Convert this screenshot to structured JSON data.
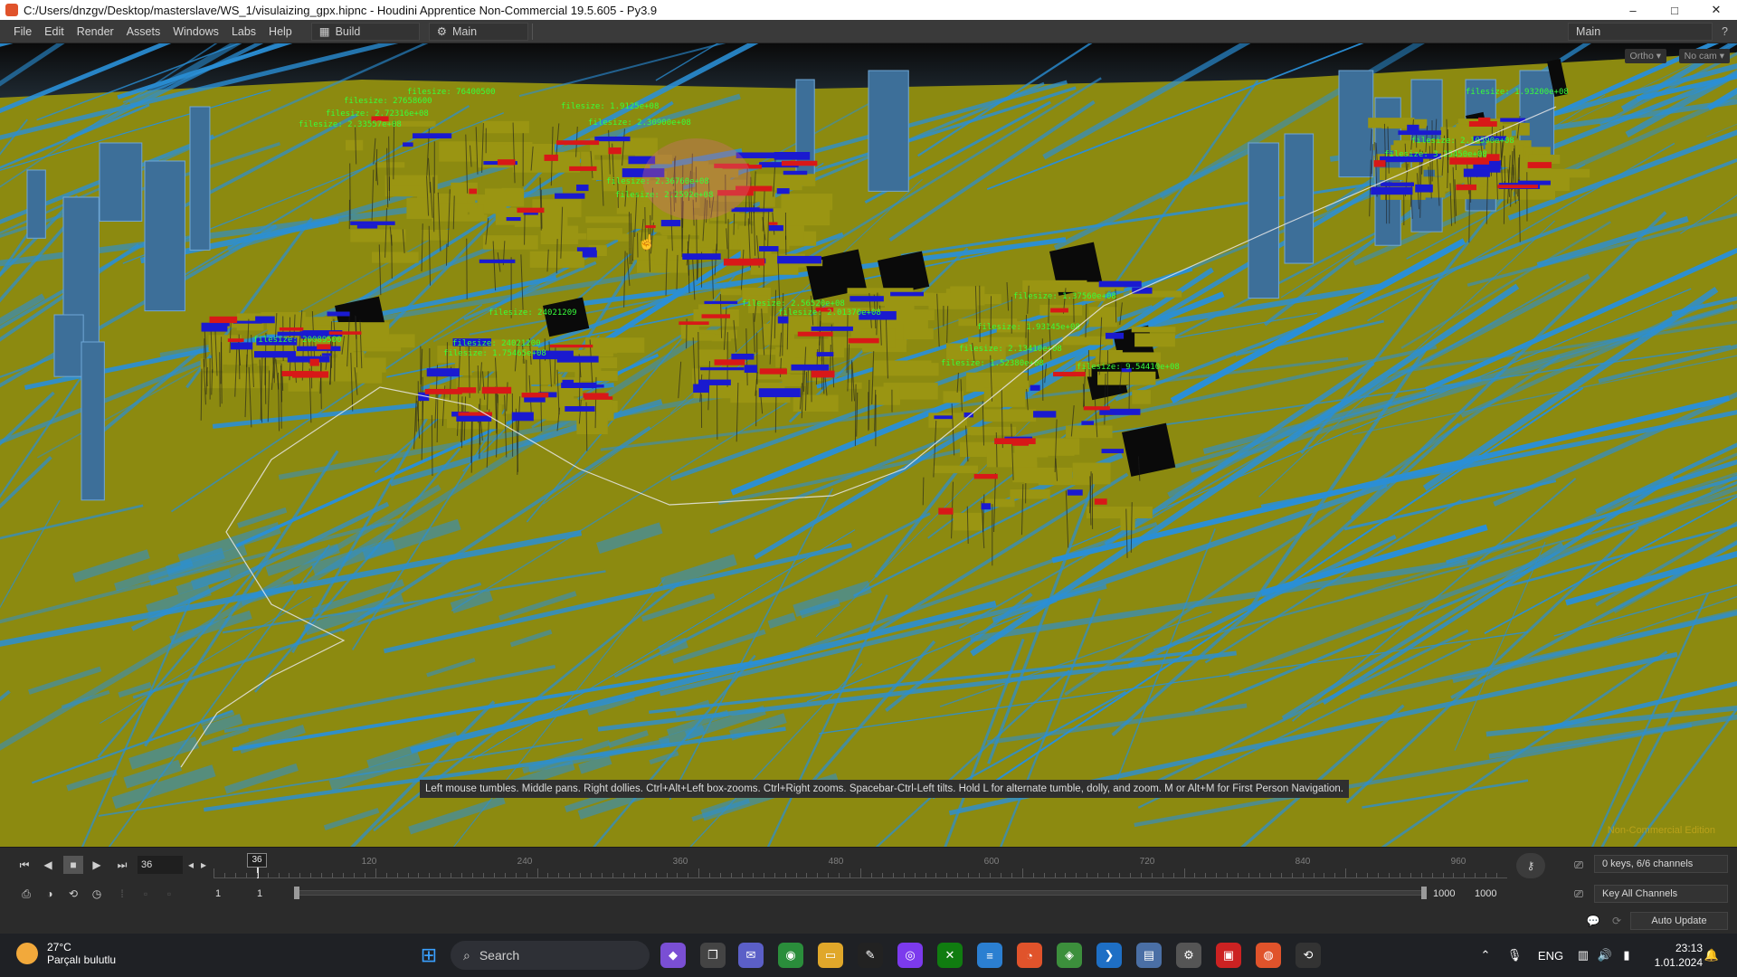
{
  "window": {
    "title": "C:/Users/dnzgv/Desktop/masterslave/WS_1/visulaizing_gpx.hipnc - Houdini Apprentice Non-Commercial 19.5.605 - Py3.9",
    "min": "–",
    "max": "□",
    "close": "✕"
  },
  "menu": {
    "items": [
      "File",
      "Edit",
      "Render",
      "Assets",
      "Windows",
      "Labs",
      "Help"
    ],
    "desktop_build": "Build",
    "desktop_main": "Main",
    "right_desk": "Main"
  },
  "viewport": {
    "cam_ortho": "Ortho ▾",
    "cam_nocam": "No cam ▾",
    "status_hint": "Left mouse tumbles. Middle pans. Right dollies. Ctrl+Alt+Left box-zooms. Ctrl+Right zooms. Spacebar-Ctrl-Left tilts. Hold L for alternate tumble, dolly, and zoom.    M or Alt+M for First Person Navigation.",
    "noncommercial": "Non-Commercial Edition",
    "labels": [
      "filesize: 76400500",
      "filesize: 27658600",
      "filesize: 2.72316e+08",
      "filesize: 2.33557e+08",
      "filesize: 1.9125e+08",
      "filesize: 2.30900e+08",
      "filesize: 2.36760e+08",
      "filesize: 2.2592e+08",
      "filesize: 24021209",
      "filesize: 20089500",
      "filesize: 24021200",
      "filesize: 1.75465e+08",
      "filesize: 2.56520e+08",
      "filesize: 2.01370e+08",
      "filesize: 1.93145e+08",
      "filesize: 1.37560e+08",
      "filesize: 1.52380e+08",
      "filesize: 2.13410e+08",
      "filesize: 9.54410e+08",
      "filesize: 1.93200e+08",
      "filesize: 2.10590e+08",
      "filesize: 3.25450e+08"
    ]
  },
  "timeline": {
    "current_frame": "36",
    "marker_frame": "36",
    "ticks": [
      "120",
      "240",
      "360",
      "480",
      "600",
      "720",
      "840",
      "960"
    ],
    "start_a": "1",
    "start_b": "1",
    "end_a": "1000",
    "end_b": "1000",
    "keys_info": "0 keys, 6/6 channels",
    "key_all": "Key All Channels",
    "auto_update": "Auto Update"
  },
  "taskbar": {
    "temp": "27°C",
    "weather_desc": "Parçalı bulutlu",
    "search": "Search",
    "lang": "ENG",
    "time": "23:13",
    "date": "1.01.2024"
  },
  "colors": {
    "ground": "#8c8a10",
    "roads": "#2a8fd6",
    "highlight_red": "#d81818",
    "highlight_blue": "#1a1ad0",
    "label_green": "#38ff3a"
  }
}
